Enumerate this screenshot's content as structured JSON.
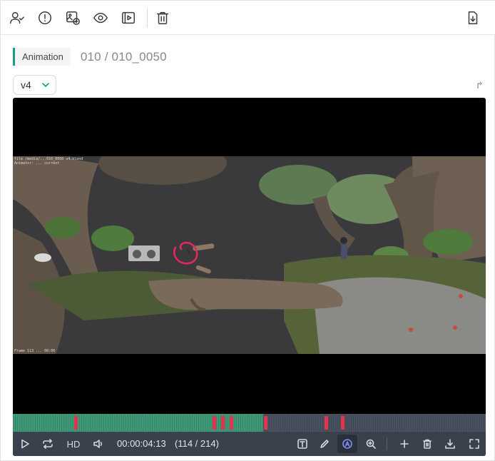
{
  "toolbar": {
    "icons": [
      "assign-user-icon",
      "alert-icon",
      "add-image-icon",
      "eye-icon",
      "play-frame-icon",
      "trash-icon",
      "download-icon"
    ]
  },
  "header": {
    "task_type": "Animation",
    "shot": "010 / 010_0050"
  },
  "version": {
    "selected": "v4"
  },
  "video": {
    "hud_top_line1": "file /media/...010_0050 v4.blend",
    "hud_top_line2": "Animator: ... current",
    "hud_bottom": "Frame 113 ... 00:00"
  },
  "timeline": {
    "total_frames": 214,
    "current_frame": 114,
    "played_fraction": 0.53,
    "markers_fraction": [
      0.129,
      0.422,
      0.44,
      0.458,
      0.531,
      0.659,
      0.694
    ],
    "colors": {
      "played": "#3f9a78",
      "unplayed": "#4a5260",
      "marker": "#e0344f"
    }
  },
  "controls": {
    "quality": "HD",
    "timecode": "00:00:04:13",
    "frame_counter": "(114 / 214)"
  }
}
